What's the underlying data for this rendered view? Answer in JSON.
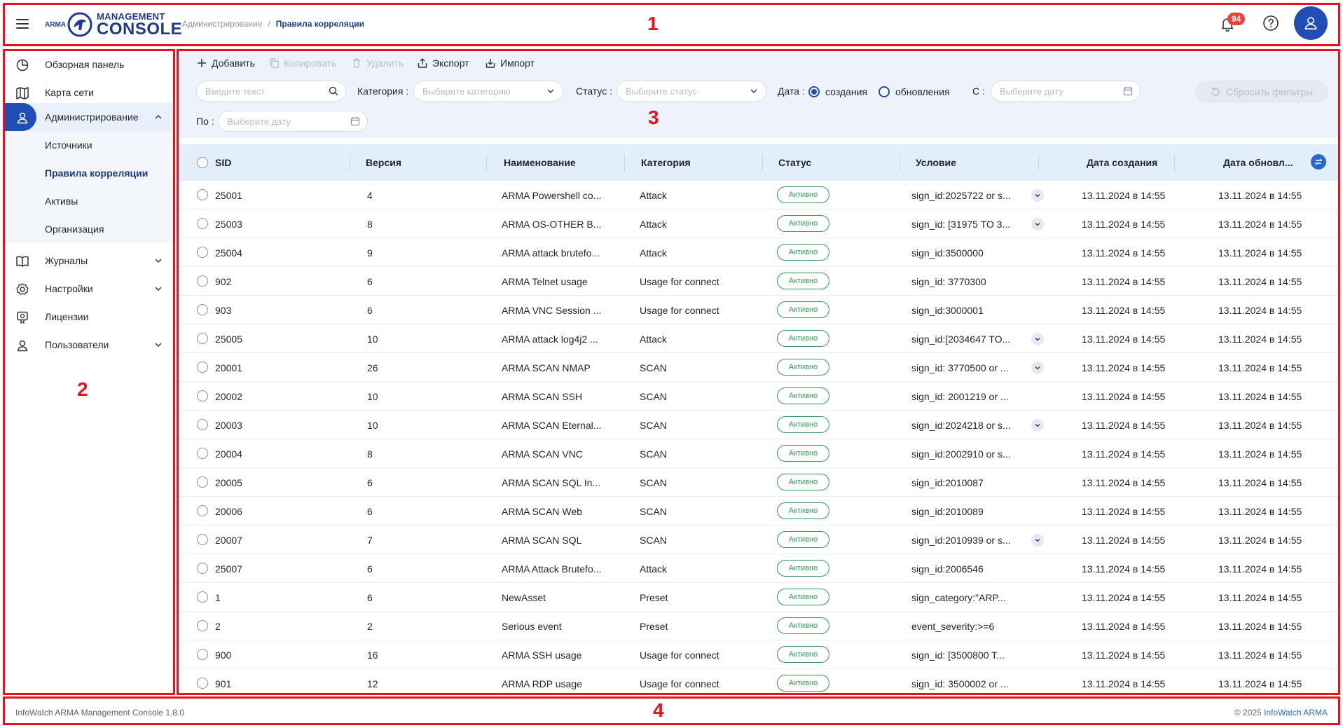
{
  "header": {
    "logo": {
      "arma": "ARMA",
      "line1": "MANAGEMENT",
      "line2": "CONSOLE"
    },
    "breadcrumb": {
      "parent": "Администрирование",
      "separator": "/",
      "current": "Правила корреляции"
    },
    "notifications_count": "94"
  },
  "sidebar": {
    "items": [
      {
        "label": "Обзорная панель",
        "icon": "dashboard-icon"
      },
      {
        "label": "Карта сети",
        "icon": "map-icon"
      },
      {
        "label": "Администрирование",
        "icon": "user-icon",
        "expanded": true
      },
      {
        "label": "Журналы",
        "icon": "book-icon"
      },
      {
        "label": "Настройки",
        "icon": "gear-icon"
      },
      {
        "label": "Лицензии",
        "icon": "license-icon"
      },
      {
        "label": "Пользователи",
        "icon": "user-icon"
      }
    ],
    "sub_items": [
      "Источники",
      "Правила корреляции",
      "Активы",
      "Организация"
    ]
  },
  "toolbar": {
    "add": "Добавить",
    "copy": "Копировать",
    "delete": "Удалить",
    "export": "Экспорт",
    "import": "Импорт"
  },
  "filters": {
    "search_placeholder": "Введите текст",
    "category_label": "Категория :",
    "category_placeholder": "Выберите категорию",
    "status_label": "Статус :",
    "status_placeholder": "Выберите статус",
    "date_label": "Дата :",
    "date_created": "создания",
    "date_updated": "обновления",
    "from_label": "С :",
    "from_placeholder": "Выберите дату",
    "to_label": "По :",
    "to_placeholder": "Выберите дату",
    "reset": "Сбросить фильтры"
  },
  "table": {
    "columns": [
      "SID",
      "Версия",
      "Наименование",
      "Категория",
      "Статус",
      "Условие",
      "Дата создания",
      "Дата обновл..."
    ],
    "rows": [
      {
        "sid": "25001",
        "version": "4",
        "name": "ARMA Powershell co...",
        "category": "Attack",
        "status": "Активно",
        "condition": "sign_id:2025722 or s...",
        "expand": true,
        "created": "13.11.2024 в 14:55",
        "updated": "13.11.2024 в 14:55"
      },
      {
        "sid": "25003",
        "version": "8",
        "name": "ARMA OS-OTHER B...",
        "category": "Attack",
        "status": "Активно",
        "condition": "sign_id: [31975 TO 3...",
        "expand": true,
        "created": "13.11.2024 в 14:55",
        "updated": "13.11.2024 в 14:55"
      },
      {
        "sid": "25004",
        "version": "9",
        "name": "ARMA attack brutefo...",
        "category": "Attack",
        "status": "Активно",
        "condition": "sign_id:3500000",
        "expand": false,
        "created": "13.11.2024 в 14:55",
        "updated": "13.11.2024 в 14:55"
      },
      {
        "sid": "902",
        "version": "6",
        "name": "ARMA Telnet usage",
        "category": "Usage for connect",
        "status": "Активно",
        "condition": "sign_id: 3770300",
        "expand": false,
        "created": "13.11.2024 в 14:55",
        "updated": "13.11.2024 в 14:55"
      },
      {
        "sid": "903",
        "version": "6",
        "name": "ARMA VNC Session ...",
        "category": "Usage for connect",
        "status": "Активно",
        "condition": "sign_id:3000001",
        "expand": false,
        "created": "13.11.2024 в 14:55",
        "updated": "13.11.2024 в 14:55"
      },
      {
        "sid": "25005",
        "version": "10",
        "name": "ARMA attack log4j2 ...",
        "category": "Attack",
        "status": "Активно",
        "condition": "sign_id:[2034647 TO...",
        "expand": true,
        "created": "13.11.2024 в 14:55",
        "updated": "13.11.2024 в 14:55"
      },
      {
        "sid": "20001",
        "version": "26",
        "name": "ARMA SCAN NMAP",
        "category": "SCAN",
        "status": "Активно",
        "condition": "sign_id: 3770500 or ...",
        "expand": true,
        "created": "13.11.2024 в 14:55",
        "updated": "13.11.2024 в 14:55"
      },
      {
        "sid": "20002",
        "version": "10",
        "name": "ARMA SCAN SSH",
        "category": "SCAN",
        "status": "Активно",
        "condition": "sign_id: 2001219 or ...",
        "expand": false,
        "created": "13.11.2024 в 14:55",
        "updated": "13.11.2024 в 14:55"
      },
      {
        "sid": "20003",
        "version": "10",
        "name": "ARMA SCAN Eternal...",
        "category": "SCAN",
        "status": "Активно",
        "condition": "sign_id:2024218 or s...",
        "expand": true,
        "created": "13.11.2024 в 14:55",
        "updated": "13.11.2024 в 14:55"
      },
      {
        "sid": "20004",
        "version": "8",
        "name": "ARMA SCAN VNC",
        "category": "SCAN",
        "status": "Активно",
        "condition": "sign_id:2002910 or s...",
        "expand": false,
        "created": "13.11.2024 в 14:55",
        "updated": "13.11.2024 в 14:55"
      },
      {
        "sid": "20005",
        "version": "6",
        "name": "ARMA SCAN SQL In...",
        "category": "SCAN",
        "status": "Активно",
        "condition": "sign_id:2010087",
        "expand": false,
        "created": "13.11.2024 в 14:55",
        "updated": "13.11.2024 в 14:55"
      },
      {
        "sid": "20006",
        "version": "6",
        "name": "ARMA SCAN Web",
        "category": "SCAN",
        "status": "Активно",
        "condition": "sign_id:2010089",
        "expand": false,
        "created": "13.11.2024 в 14:55",
        "updated": "13.11.2024 в 14:55"
      },
      {
        "sid": "20007",
        "version": "7",
        "name": "ARMA SCAN SQL",
        "category": "SCAN",
        "status": "Активно",
        "condition": "sign_id:2010939 or s...",
        "expand": true,
        "created": "13.11.2024 в 14:55",
        "updated": "13.11.2024 в 14:55"
      },
      {
        "sid": "25007",
        "version": "6",
        "name": "ARMA Attack Brutefo...",
        "category": "Attack",
        "status": "Активно",
        "condition": "sign_id:2006546",
        "expand": false,
        "created": "13.11.2024 в 14:55",
        "updated": "13.11.2024 в 14:55"
      },
      {
        "sid": "1",
        "version": "6",
        "name": "NewAsset",
        "category": "Preset",
        "status": "Активно",
        "condition": "sign_category:\"ARP...",
        "expand": false,
        "created": "13.11.2024 в 14:55",
        "updated": "13.11.2024 в 14:55"
      },
      {
        "sid": "2",
        "version": "2",
        "name": "Serious event",
        "category": "Preset",
        "status": "Активно",
        "condition": "event_severity:>=6",
        "expand": false,
        "created": "13.11.2024 в 14:55",
        "updated": "13.11.2024 в 14:55"
      },
      {
        "sid": "900",
        "version": "16",
        "name": "ARMA SSH usage",
        "category": "Usage for connect",
        "status": "Активно",
        "condition": "sign_id: [3500800 T...",
        "expand": false,
        "created": "13.11.2024 в 14:55",
        "updated": "13.11.2024 в 14:55"
      },
      {
        "sid": "901",
        "version": "12",
        "name": "ARMA RDP usage",
        "category": "Usage for connect",
        "status": "Активно",
        "condition": "sign_id: 3500002 or ...",
        "expand": false,
        "created": "13.11.2024 в 14:55",
        "updated": "13.11.2024 в 14:55"
      }
    ]
  },
  "footer": {
    "left": "InfoWatch ARMA Management Console 1.8.0",
    "copyright": "© 2025",
    "link": "InfoWatch ARMA"
  },
  "annotations": [
    "1",
    "2",
    "3",
    "4"
  ],
  "colors": {
    "accent": "#1f4fb5",
    "annotation": "#e3141c",
    "status_active": "#2e9b58",
    "badge": "#e8403a"
  }
}
